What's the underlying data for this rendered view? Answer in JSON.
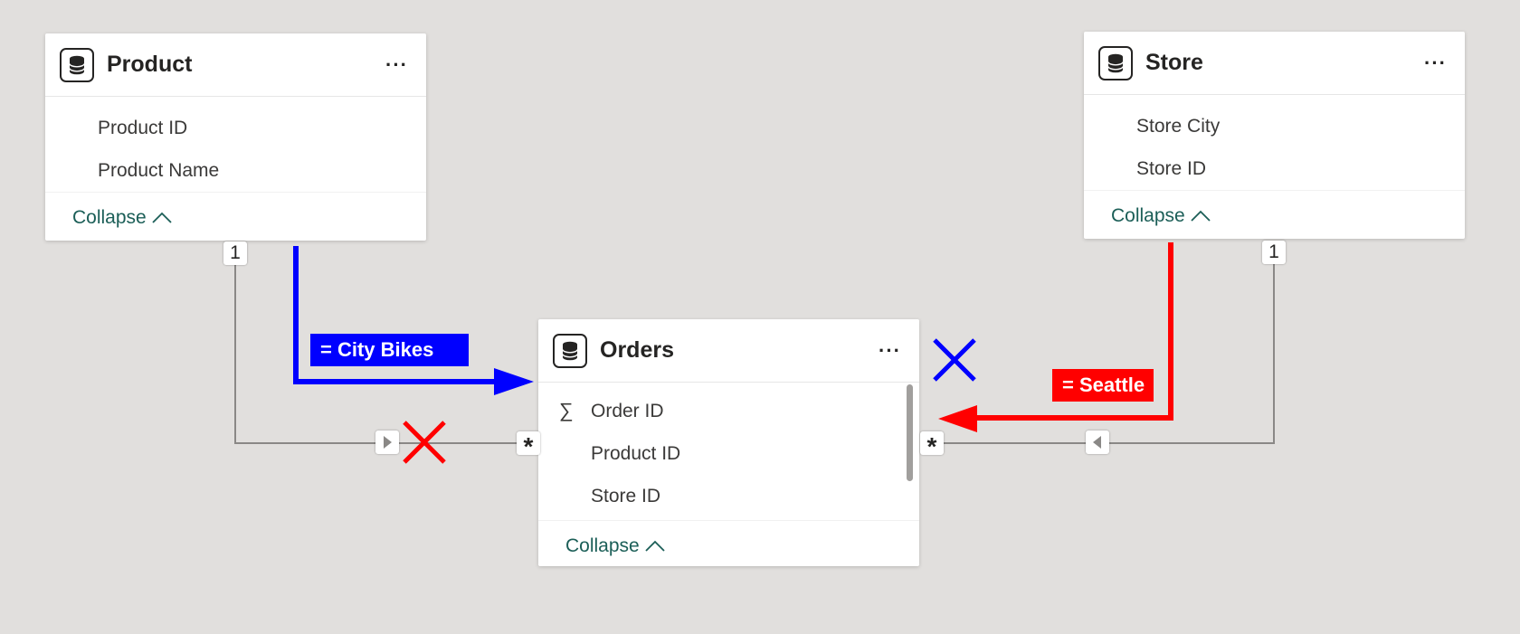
{
  "tables": [
    {
      "id": "product",
      "title": "Product",
      "fields": [
        "Product ID",
        "Product Name"
      ],
      "collapse_label": "Collapse"
    },
    {
      "id": "store",
      "title": "Store",
      "fields": [
        "Store City",
        "Store ID"
      ],
      "collapse_label": "Collapse"
    },
    {
      "id": "orders",
      "title": "Orders",
      "fields": [
        "Order ID",
        "Product ID",
        "Store ID"
      ],
      "collapse_label": "Collapse"
    }
  ],
  "cardinality": {
    "product_one": "1",
    "store_one": "1",
    "orders_many_left": "*",
    "orders_many_right": "*"
  },
  "filters": {
    "product": {
      "text": "= City Bikes",
      "color": "#0000ff"
    },
    "store": {
      "text": "= Seattle",
      "color": "#ff0000"
    }
  },
  "colors": {
    "background": "#e1dfdd",
    "relationship_line": "#8a8886",
    "collapse_link": "#1b5e57",
    "cross_red": "#ff0000",
    "cross_blue": "#0000ff"
  },
  "icons": {
    "table": "database-icon",
    "more": "more-options-icon",
    "collapse": "chevron-up-icon",
    "aggregate": "sigma-icon",
    "filter_direction_right": "triangle-right-icon",
    "filter_direction_left": "triangle-left-icon",
    "cross": "x-mark-icon"
  }
}
